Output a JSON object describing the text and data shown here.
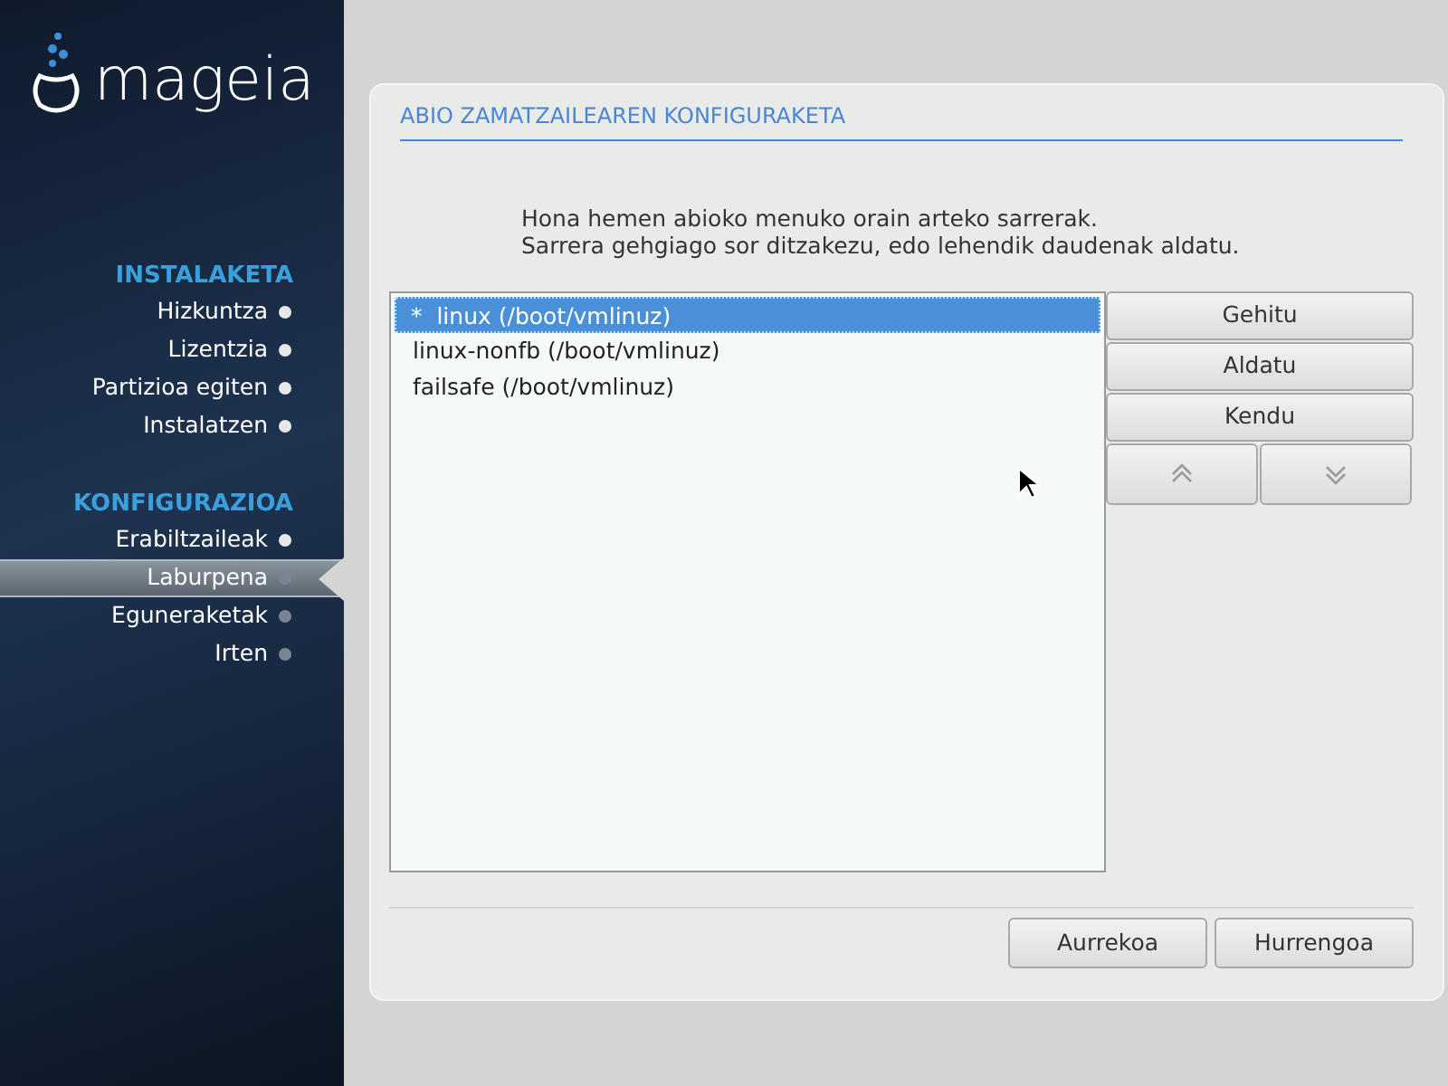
{
  "logo": {
    "text": "mageia"
  },
  "sidebar": {
    "sections": [
      {
        "title": "INSTALAKETA",
        "items": [
          {
            "label": "Hizkuntza",
            "done": true,
            "selected": false
          },
          {
            "label": "Lizentzia",
            "done": true,
            "selected": false
          },
          {
            "label": "Partizioa egiten",
            "done": true,
            "selected": false
          },
          {
            "label": "Instalatzen",
            "done": true,
            "selected": false
          }
        ]
      },
      {
        "title": "KONFIGURAZIOA",
        "items": [
          {
            "label": "Erabiltzaileak",
            "done": true,
            "selected": false
          },
          {
            "label": "Laburpena",
            "done": false,
            "selected": true
          },
          {
            "label": "Eguneraketak",
            "done": false,
            "selected": false
          },
          {
            "label": "Irten",
            "done": false,
            "selected": false
          }
        ]
      }
    ]
  },
  "panel": {
    "title": "ABIO ZAMATZAILEAREN KONFIGURAKETA",
    "description": [
      "Hona hemen abioko menuko orain arteko sarrerak.",
      "Sarrera gehgiago sor ditzakezu, edo lehendik daudenak aldatu."
    ],
    "entries": [
      {
        "label": "*  linux (/boot/vmlinuz)",
        "selected": true
      },
      {
        "label": "linux-nonfb (/boot/vmlinuz)",
        "selected": false
      },
      {
        "label": "failsafe (/boot/vmlinuz)",
        "selected": false
      }
    ],
    "buttons": [
      "Gehitu",
      "Aldatu",
      "Kendu"
    ],
    "footer_buttons": [
      "Aurrekoa",
      "Hurrengoa"
    ]
  }
}
